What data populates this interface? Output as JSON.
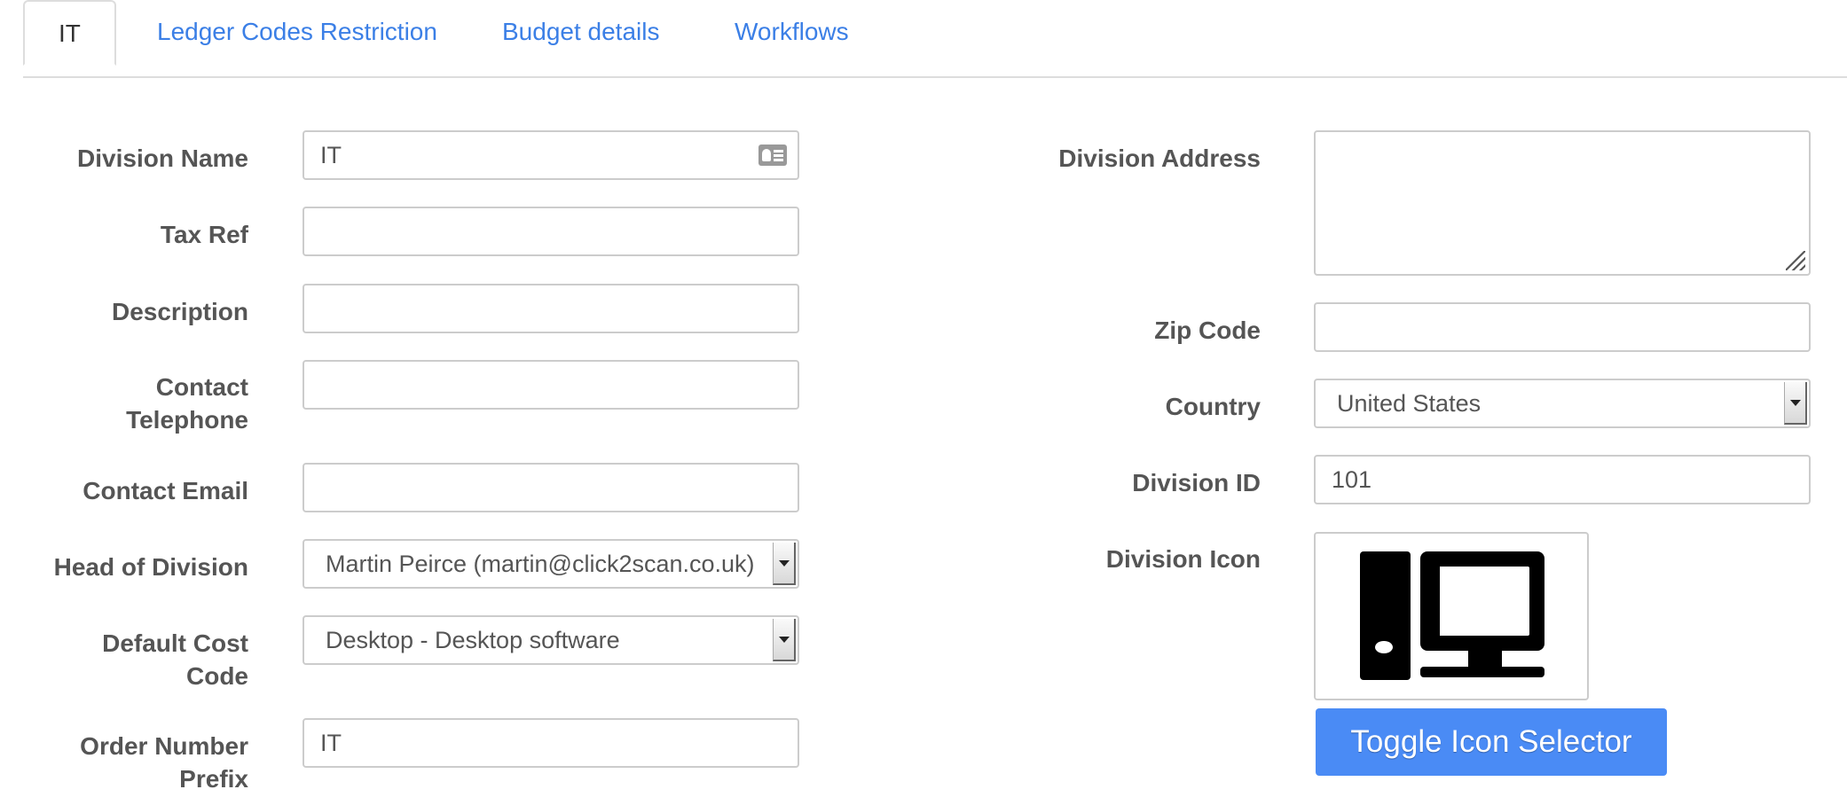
{
  "tabs": [
    {
      "label": "IT",
      "active": true
    },
    {
      "label": "Ledger Codes Restriction",
      "active": false
    },
    {
      "label": "Budget details",
      "active": false
    },
    {
      "label": "Workflows",
      "active": false
    }
  ],
  "left_form": {
    "division_name": {
      "label": "Division Name",
      "value": "IT"
    },
    "tax_ref": {
      "label": "Tax Ref",
      "value": ""
    },
    "description": {
      "label": "Description",
      "value": ""
    },
    "contact_telephone": {
      "label": "Contact Telephone",
      "value": ""
    },
    "contact_email": {
      "label": "Contact Email",
      "value": ""
    },
    "head_of_division": {
      "label": "Head of Division",
      "value": "Martin Peirce (martin@click2scan.co.uk)"
    },
    "default_cost_code": {
      "label": "Default Cost Code",
      "value": "Desktop - Desktop software"
    },
    "order_number_prefix": {
      "label": "Order Number Prefix",
      "value": "IT"
    }
  },
  "right_form": {
    "division_address": {
      "label": "Division Address",
      "value": ""
    },
    "zip_code": {
      "label": "Zip Code",
      "value": ""
    },
    "country": {
      "label": "Country",
      "value": "United States"
    },
    "division_id": {
      "label": "Division ID",
      "value": "101"
    },
    "division_icon": {
      "label": "Division Icon",
      "icon": "desktop-computer-icon"
    },
    "toggle_button": "Toggle Icon Selector"
  },
  "colors": {
    "link": "#3b7fe6",
    "button": "#4a8bf5",
    "border": "#cccccc"
  }
}
